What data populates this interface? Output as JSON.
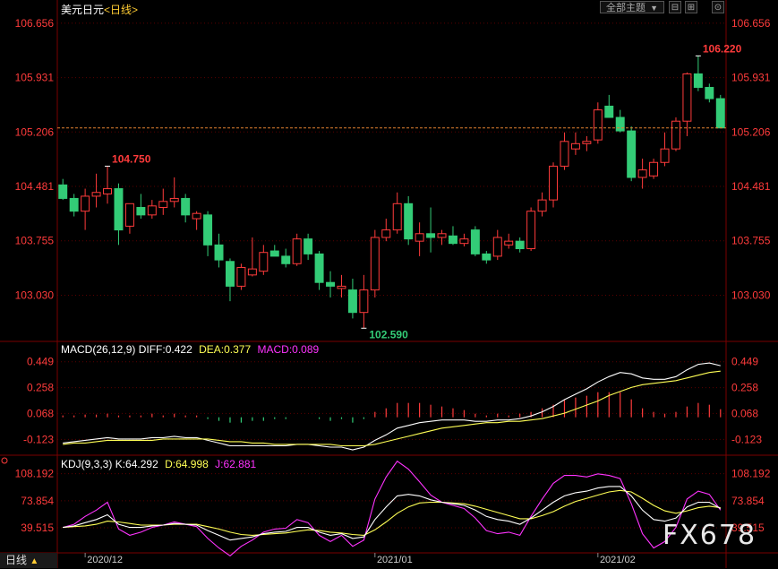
{
  "header": {
    "symbol": "美元日元",
    "period": "<日线>",
    "theme_dropdown": "全部主题",
    "dropdown_arrow": "▼",
    "window_buttons": [
      "⊟",
      "⊞",
      "⊙"
    ]
  },
  "price_axis_labels": [
    "106.656",
    "105.931",
    "105.206",
    "104.481",
    "103.755",
    "103.030"
  ],
  "macd_panel": {
    "title": "MACD(26,12,9)",
    "diff_label": "DIFF:0.422",
    "dea_label": "DEA:0.377",
    "macd_label": "MACD:0.089",
    "axis_labels": [
      "0.449",
      "0.258",
      "0.068",
      "-0.123"
    ]
  },
  "kdj_panel": {
    "title": "KDJ(9,3,3)",
    "k_label": "K:64.292",
    "d_label": "D:64.998",
    "j_label": "J:62.881",
    "axis_labels": [
      "108.192",
      "73.854",
      "39.515"
    ]
  },
  "bottom_tab": {
    "label": "日线",
    "arrow": "▲"
  },
  "watermark": "FX678",
  "colors": {
    "up": "#ff3b3b",
    "down": "#33cc77",
    "axis_text": "#ff3b3b",
    "grid": "#5a0000",
    "diff": "#ffffff",
    "dea": "#ffff55",
    "macd_text": "#ff33ff",
    "k": "#ffffff",
    "d": "#ffff55",
    "j": "#ff33ff",
    "last_price_line": "#e08030"
  },
  "chart_data": [
    {
      "type": "candlestick",
      "title": "美元日元",
      "x_labels": [
        "2020/12",
        "2021/01",
        "2021/02"
      ],
      "y_ticks": [
        106.656,
        105.931,
        105.206,
        104.481,
        103.755,
        103.03
      ],
      "ylim": [
        102.45,
        106.75
      ],
      "last_price": 105.26,
      "annotations": [
        {
          "text": "104.750",
          "value": 104.75,
          "kind": "high"
        },
        {
          "text": "102.590",
          "value": 102.59,
          "kind": "low"
        },
        {
          "text": "106.220",
          "value": 106.22,
          "kind": "high"
        }
      ],
      "candles": [
        {
          "o": 104.5,
          "h": 104.58,
          "l": 104.3,
          "c": 104.32
        },
        {
          "o": 104.32,
          "h": 104.38,
          "l": 104.08,
          "c": 104.15
        },
        {
          "o": 104.15,
          "h": 104.45,
          "l": 103.9,
          "c": 104.35
        },
        {
          "o": 104.35,
          "h": 104.65,
          "l": 104.2,
          "c": 104.4
        },
        {
          "o": 104.38,
          "h": 104.75,
          "l": 104.25,
          "c": 104.45
        },
        {
          "o": 104.45,
          "h": 104.52,
          "l": 103.7,
          "c": 103.9
        },
        {
          "o": 103.95,
          "h": 104.2,
          "l": 103.85,
          "c": 104.25
        },
        {
          "o": 104.2,
          "h": 104.38,
          "l": 104.05,
          "c": 104.1
        },
        {
          "o": 104.1,
          "h": 104.3,
          "l": 104.05,
          "c": 104.22
        },
        {
          "o": 104.2,
          "h": 104.45,
          "l": 104.1,
          "c": 104.28
        },
        {
          "o": 104.28,
          "h": 104.6,
          "l": 104.2,
          "c": 104.32
        },
        {
          "o": 104.32,
          "h": 104.38,
          "l": 104.0,
          "c": 104.1
        },
        {
          "o": 104.05,
          "h": 104.15,
          "l": 103.9,
          "c": 104.12
        },
        {
          "o": 104.1,
          "h": 104.15,
          "l": 103.55,
          "c": 103.7
        },
        {
          "o": 103.7,
          "h": 103.85,
          "l": 103.4,
          "c": 103.5
        },
        {
          "o": 103.48,
          "h": 103.52,
          "l": 102.95,
          "c": 103.15
        },
        {
          "o": 103.15,
          "h": 103.45,
          "l": 103.1,
          "c": 103.4
        },
        {
          "o": 103.3,
          "h": 103.8,
          "l": 103.28,
          "c": 103.38
        },
        {
          "o": 103.35,
          "h": 103.7,
          "l": 103.3,
          "c": 103.6
        },
        {
          "o": 103.62,
          "h": 103.7,
          "l": 103.55,
          "c": 103.55
        },
        {
          "o": 103.55,
          "h": 103.65,
          "l": 103.4,
          "c": 103.45
        },
        {
          "o": 103.45,
          "h": 103.85,
          "l": 103.42,
          "c": 103.78
        },
        {
          "o": 103.78,
          "h": 103.85,
          "l": 103.5,
          "c": 103.58
        },
        {
          "o": 103.58,
          "h": 103.62,
          "l": 103.1,
          "c": 103.2
        },
        {
          "o": 103.2,
          "h": 103.35,
          "l": 103.0,
          "c": 103.15
        },
        {
          "o": 103.12,
          "h": 103.3,
          "l": 103.0,
          "c": 103.15
        },
        {
          "o": 103.1,
          "h": 103.25,
          "l": 102.72,
          "c": 102.8
        },
        {
          "o": 102.8,
          "h": 103.3,
          "l": 102.59,
          "c": 103.1
        },
        {
          "o": 103.1,
          "h": 103.9,
          "l": 103.0,
          "c": 103.8
        },
        {
          "o": 103.8,
          "h": 104.05,
          "l": 103.75,
          "c": 103.9
        },
        {
          "o": 103.9,
          "h": 104.4,
          "l": 103.85,
          "c": 104.25
        },
        {
          "o": 104.25,
          "h": 104.35,
          "l": 103.7,
          "c": 103.78
        },
        {
          "o": 103.75,
          "h": 104.0,
          "l": 103.55,
          "c": 103.85
        },
        {
          "o": 103.85,
          "h": 104.2,
          "l": 103.6,
          "c": 103.8
        },
        {
          "o": 103.8,
          "h": 103.9,
          "l": 103.7,
          "c": 103.85
        },
        {
          "o": 103.82,
          "h": 103.95,
          "l": 103.7,
          "c": 103.72
        },
        {
          "o": 103.72,
          "h": 103.85,
          "l": 103.68,
          "c": 103.78
        },
        {
          "o": 103.9,
          "h": 103.95,
          "l": 103.55,
          "c": 103.58
        },
        {
          "o": 103.58,
          "h": 103.62,
          "l": 103.45,
          "c": 103.5
        },
        {
          "o": 103.55,
          "h": 103.9,
          "l": 103.5,
          "c": 103.8
        },
        {
          "o": 103.7,
          "h": 103.85,
          "l": 103.65,
          "c": 103.75
        },
        {
          "o": 103.75,
          "h": 103.8,
          "l": 103.6,
          "c": 103.65
        },
        {
          "o": 103.65,
          "h": 104.2,
          "l": 103.62,
          "c": 104.15
        },
        {
          "o": 104.15,
          "h": 104.4,
          "l": 104.08,
          "c": 104.3
        },
        {
          "o": 104.3,
          "h": 104.8,
          "l": 104.2,
          "c": 104.75
        },
        {
          "o": 104.75,
          "h": 105.2,
          "l": 104.7,
          "c": 105.08
        },
        {
          "o": 104.98,
          "h": 105.2,
          "l": 104.9,
          "c": 105.05
        },
        {
          "o": 105.05,
          "h": 105.15,
          "l": 104.95,
          "c": 105.08
        },
        {
          "o": 105.1,
          "h": 105.6,
          "l": 105.05,
          "c": 105.5
        },
        {
          "o": 105.55,
          "h": 105.7,
          "l": 105.4,
          "c": 105.4
        },
        {
          "o": 105.4,
          "h": 105.5,
          "l": 105.2,
          "c": 105.22
        },
        {
          "o": 105.22,
          "h": 105.28,
          "l": 104.55,
          "c": 104.6
        },
        {
          "o": 104.6,
          "h": 104.85,
          "l": 104.45,
          "c": 104.7
        },
        {
          "o": 104.62,
          "h": 104.85,
          "l": 104.58,
          "c": 104.8
        },
        {
          "o": 104.8,
          "h": 105.2,
          "l": 104.75,
          "c": 104.98
        },
        {
          "o": 104.98,
          "h": 105.4,
          "l": 104.95,
          "c": 105.35
        },
        {
          "o": 105.35,
          "h": 106.0,
          "l": 105.15,
          "c": 105.98
        },
        {
          "o": 105.98,
          "h": 106.22,
          "l": 105.75,
          "c": 105.8
        },
        {
          "o": 105.8,
          "h": 105.85,
          "l": 105.6,
          "c": 105.65
        },
        {
          "o": 105.65,
          "h": 105.7,
          "l": 105.26,
          "c": 105.26
        }
      ]
    },
    {
      "type": "line+bar",
      "title": "MACD(26,12,9)",
      "y_ticks": [
        0.449,
        0.258,
        0.068,
        -0.123
      ],
      "ylim": [
        -0.2,
        0.52
      ],
      "series": [
        {
          "name": "DIFF",
          "values": [
            -0.15,
            -0.14,
            -0.13,
            -0.12,
            -0.11,
            -0.12,
            -0.12,
            -0.12,
            -0.11,
            -0.11,
            -0.1,
            -0.11,
            -0.11,
            -0.13,
            -0.15,
            -0.17,
            -0.17,
            -0.17,
            -0.17,
            -0.17,
            -0.17,
            -0.16,
            -0.16,
            -0.17,
            -0.18,
            -0.18,
            -0.2,
            -0.18,
            -0.13,
            -0.09,
            -0.04,
            -0.02,
            0,
            0.01,
            0.02,
            0.02,
            0.02,
            0.01,
            0.01,
            0.02,
            0.02,
            0.03,
            0.05,
            0.08,
            0.12,
            0.17,
            0.21,
            0.25,
            0.3,
            0.34,
            0.37,
            0.36,
            0.33,
            0.32,
            0.32,
            0.34,
            0.39,
            0.43,
            0.44,
            0.42
          ]
        },
        {
          "name": "DEA",
          "values": [
            -0.16,
            -0.15,
            -0.15,
            -0.14,
            -0.13,
            -0.13,
            -0.13,
            -0.13,
            -0.13,
            -0.12,
            -0.12,
            -0.12,
            -0.12,
            -0.12,
            -0.13,
            -0.14,
            -0.14,
            -0.15,
            -0.15,
            -0.16,
            -0.16,
            -0.16,
            -0.16,
            -0.16,
            -0.16,
            -0.17,
            -0.17,
            -0.17,
            -0.16,
            -0.14,
            -0.12,
            -0.1,
            -0.08,
            -0.06,
            -0.04,
            -0.03,
            -0.02,
            -0.01,
            0,
            0,
            0.01,
            0.01,
            0.02,
            0.03,
            0.05,
            0.07,
            0.1,
            0.13,
            0.16,
            0.2,
            0.23,
            0.26,
            0.28,
            0.29,
            0.3,
            0.31,
            0.33,
            0.35,
            0.37,
            0.38
          ]
        },
        {
          "name": "MACD",
          "values": [
            0.02,
            0.02,
            0.03,
            0.03,
            0.04,
            0.02,
            0.02,
            0.02,
            0.04,
            0.02,
            0.04,
            0.02,
            0.02,
            -0.02,
            -0.04,
            -0.06,
            -0.06,
            -0.04,
            -0.04,
            -0.02,
            -0.02,
            0,
            0,
            -0.02,
            -0.04,
            -0.02,
            -0.06,
            -0.02,
            0.06,
            0.1,
            0.16,
            0.16,
            0.16,
            0.14,
            0.12,
            0.1,
            0.08,
            0.04,
            0.02,
            0.04,
            0.02,
            0.04,
            0.06,
            0.1,
            0.14,
            0.2,
            0.22,
            0.24,
            0.28,
            0.28,
            0.28,
            0.2,
            0.1,
            0.06,
            0.04,
            0.06,
            0.12,
            0.16,
            0.14,
            0.09
          ]
        }
      ]
    },
    {
      "type": "line",
      "title": "KDJ(9,3,3)",
      "y_ticks": [
        108.192,
        73.854,
        39.515
      ],
      "ylim": [
        10,
        118
      ],
      "series": [
        {
          "name": "K",
          "values": [
            40,
            42,
            46,
            50,
            56,
            44,
            40,
            40,
            42,
            43,
            45,
            44,
            43,
            36,
            30,
            24,
            26,
            28,
            32,
            34,
            35,
            40,
            40,
            34,
            30,
            32,
            26,
            28,
            50,
            66,
            80,
            82,
            80,
            75,
            72,
            70,
            68,
            62,
            54,
            50,
            48,
            44,
            52,
            62,
            72,
            80,
            84,
            86,
            90,
            92,
            92,
            80,
            62,
            50,
            48,
            52,
            66,
            72,
            72,
            64
          ]
        },
        {
          "name": "D",
          "values": [
            40,
            41,
            42,
            44,
            48,
            47,
            45,
            43,
            43,
            43,
            44,
            44,
            44,
            41,
            38,
            34,
            31,
            30,
            31,
            32,
            33,
            35,
            37,
            36,
            34,
            33,
            31,
            30,
            37,
            47,
            58,
            66,
            71,
            72,
            72,
            71,
            70,
            67,
            63,
            59,
            55,
            51,
            51,
            55,
            60,
            67,
            73,
            77,
            81,
            85,
            87,
            85,
            77,
            68,
            61,
            58,
            61,
            65,
            67,
            65
          ]
        },
        {
          "name": "J",
          "values": [
            40,
            44,
            54,
            62,
            72,
            38,
            30,
            34,
            40,
            43,
            47,
            44,
            41,
            26,
            14,
            4,
            16,
            24,
            34,
            38,
            39,
            50,
            46,
            30,
            22,
            30,
            16,
            24,
            76,
            104,
            124,
            114,
            98,
            81,
            72,
            68,
            64,
            52,
            36,
            32,
            34,
            30,
            54,
            76,
            96,
            106,
            106,
            104,
            108,
            106,
            102,
            70,
            32,
            14,
            22,
            40,
            76,
            86,
            82,
            62
          ]
        }
      ]
    }
  ]
}
